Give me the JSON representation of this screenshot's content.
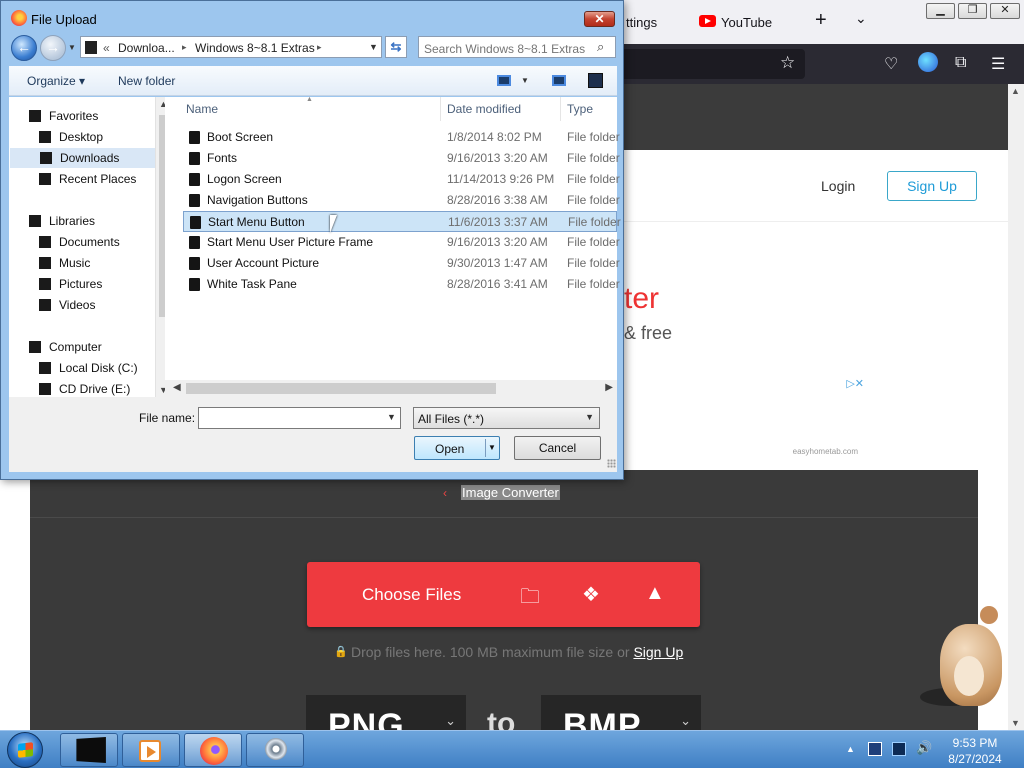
{
  "browser": {
    "tabs": [
      {
        "label": "ttings"
      },
      {
        "label": "YouTube"
      }
    ],
    "window_controls": {
      "minimize": "▁",
      "maximize": "❐",
      "close": "✕"
    },
    "new_tab": "+",
    "tab_list": "⌄",
    "icons": [
      "star-icon",
      "pocket-icon",
      "vpn-icon",
      "extensions-icon",
      "menu-icon"
    ]
  },
  "site": {
    "login": "Login",
    "signup": "Sign Up",
    "hero_title": "ter",
    "hero_sub": "& free",
    "ad_choices": "▷✕",
    "ad_url": "easyhometab.com",
    "breadcrumb_back": "‹",
    "breadcrumb": "Image Converter",
    "choose_files": "Choose Files",
    "drop_text": "Drop files here. 100 MB maximum file size or ",
    "drop_signup": "Sign Up",
    "from_format": "PNG",
    "to_word": "to",
    "to_format": "BMP",
    "accent_color": "#ee3a3f"
  },
  "dialog": {
    "title": "File Upload",
    "close": "✕",
    "address": {
      "chevron": "«",
      "segments": [
        "Downloa...",
        "Windows 8~8.1 Extras"
      ],
      "separator": "▸"
    },
    "search_placeholder": "Search Windows 8~8.1 Extras",
    "toolbar": {
      "organize": "Organize ▾",
      "new_folder": "New folder"
    },
    "nav": {
      "favorites": "Favorites",
      "desktop": "Desktop",
      "downloads": "Downloads",
      "recent_places": "Recent Places",
      "libraries": "Libraries",
      "documents": "Documents",
      "music": "Music",
      "pictures": "Pictures",
      "videos": "Videos",
      "computer": "Computer",
      "local_disk": "Local Disk (C:)",
      "cd_drive": "CD Drive (E:)"
    },
    "columns": {
      "name": "Name",
      "date": "Date modified",
      "type": "Type"
    },
    "files": [
      {
        "name": "Boot Screen",
        "date": "1/8/2014 8:02 PM",
        "type": "File folder"
      },
      {
        "name": "Fonts",
        "date": "9/16/2013 3:20 AM",
        "type": "File folder"
      },
      {
        "name": "Logon Screen",
        "date": "11/14/2013 9:26 PM",
        "type": "File folder"
      },
      {
        "name": "Navigation Buttons",
        "date": "8/28/2016 3:38 AM",
        "type": "File folder"
      },
      {
        "name": "Start Menu Button",
        "date": "11/6/2013 3:37 AM",
        "type": "File folder"
      },
      {
        "name": "Start Menu User Picture Frame",
        "date": "9/16/2013 3:20 AM",
        "type": "File folder"
      },
      {
        "name": "User Account Picture",
        "date": "9/30/2013 1:47 AM",
        "type": "File folder"
      },
      {
        "name": "White Task Pane",
        "date": "8/28/2016 3:41 AM",
        "type": "File folder"
      }
    ],
    "selected_file": "Start Menu Button",
    "file_name_label": "File name:",
    "file_name_value": "",
    "filter": "All Files (*.*)",
    "open": "Open",
    "cancel": "Cancel"
  },
  "taskbar": {
    "time": "9:53 PM",
    "date": "8/27/2024",
    "tray_arrow": "▲",
    "volume": "🔊"
  }
}
